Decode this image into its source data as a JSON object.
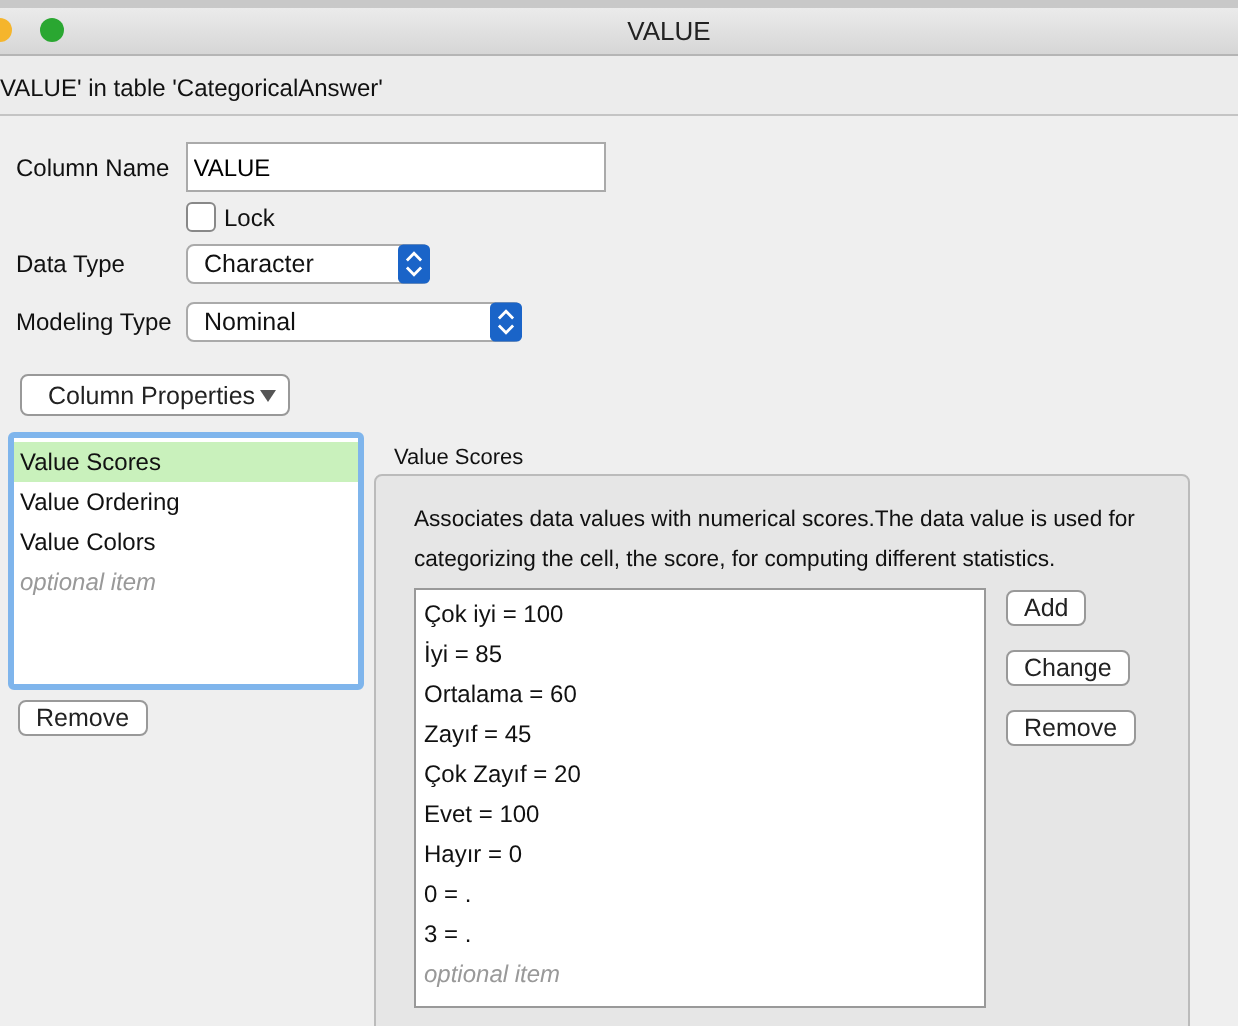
{
  "window": {
    "title": "VALUE"
  },
  "subtitle": "VALUE' in table 'CategoricalAnswer'",
  "column_name": {
    "label": "Column Name",
    "value": "VALUE"
  },
  "lock": {
    "label": "Lock",
    "checked": false
  },
  "data_type": {
    "label": "Data Type",
    "value": "Character"
  },
  "modeling_type": {
    "label": "Modeling Type",
    "value": "Nominal"
  },
  "column_properties_button": "Column Properties",
  "properties_list": [
    {
      "label": "Value Scores",
      "kind": "item",
      "selected": true
    },
    {
      "label": "Value Ordering",
      "kind": "item",
      "selected": false
    },
    {
      "label": "Value Colors",
      "kind": "item",
      "selected": false
    },
    {
      "label": "optional item",
      "kind": "placeholder",
      "selected": false
    }
  ],
  "remove_button": "Remove",
  "value_scores": {
    "title": "Value Scores",
    "description": "Associates data values with numerical scores.The data value is used for categorizing the cell, the score, for computing different statistics.",
    "items": [
      {
        "label": "Çok iyi = 100",
        "kind": "item"
      },
      {
        "label": "İyi = 85",
        "kind": "item"
      },
      {
        "label": "Ortalama = 60",
        "kind": "item"
      },
      {
        "label": "Zayıf = 45",
        "kind": "item"
      },
      {
        "label": "Çok Zayıf = 20",
        "kind": "item"
      },
      {
        "label": "Evet = 100",
        "kind": "item"
      },
      {
        "label": "Hayır = 0",
        "kind": "item"
      },
      {
        "label": "0 = .",
        "kind": "item"
      },
      {
        "label": "3 = .",
        "kind": "item"
      },
      {
        "label": "optional item",
        "kind": "placeholder"
      }
    ],
    "buttons": [
      "Add",
      "Change",
      "Remove"
    ]
  }
}
